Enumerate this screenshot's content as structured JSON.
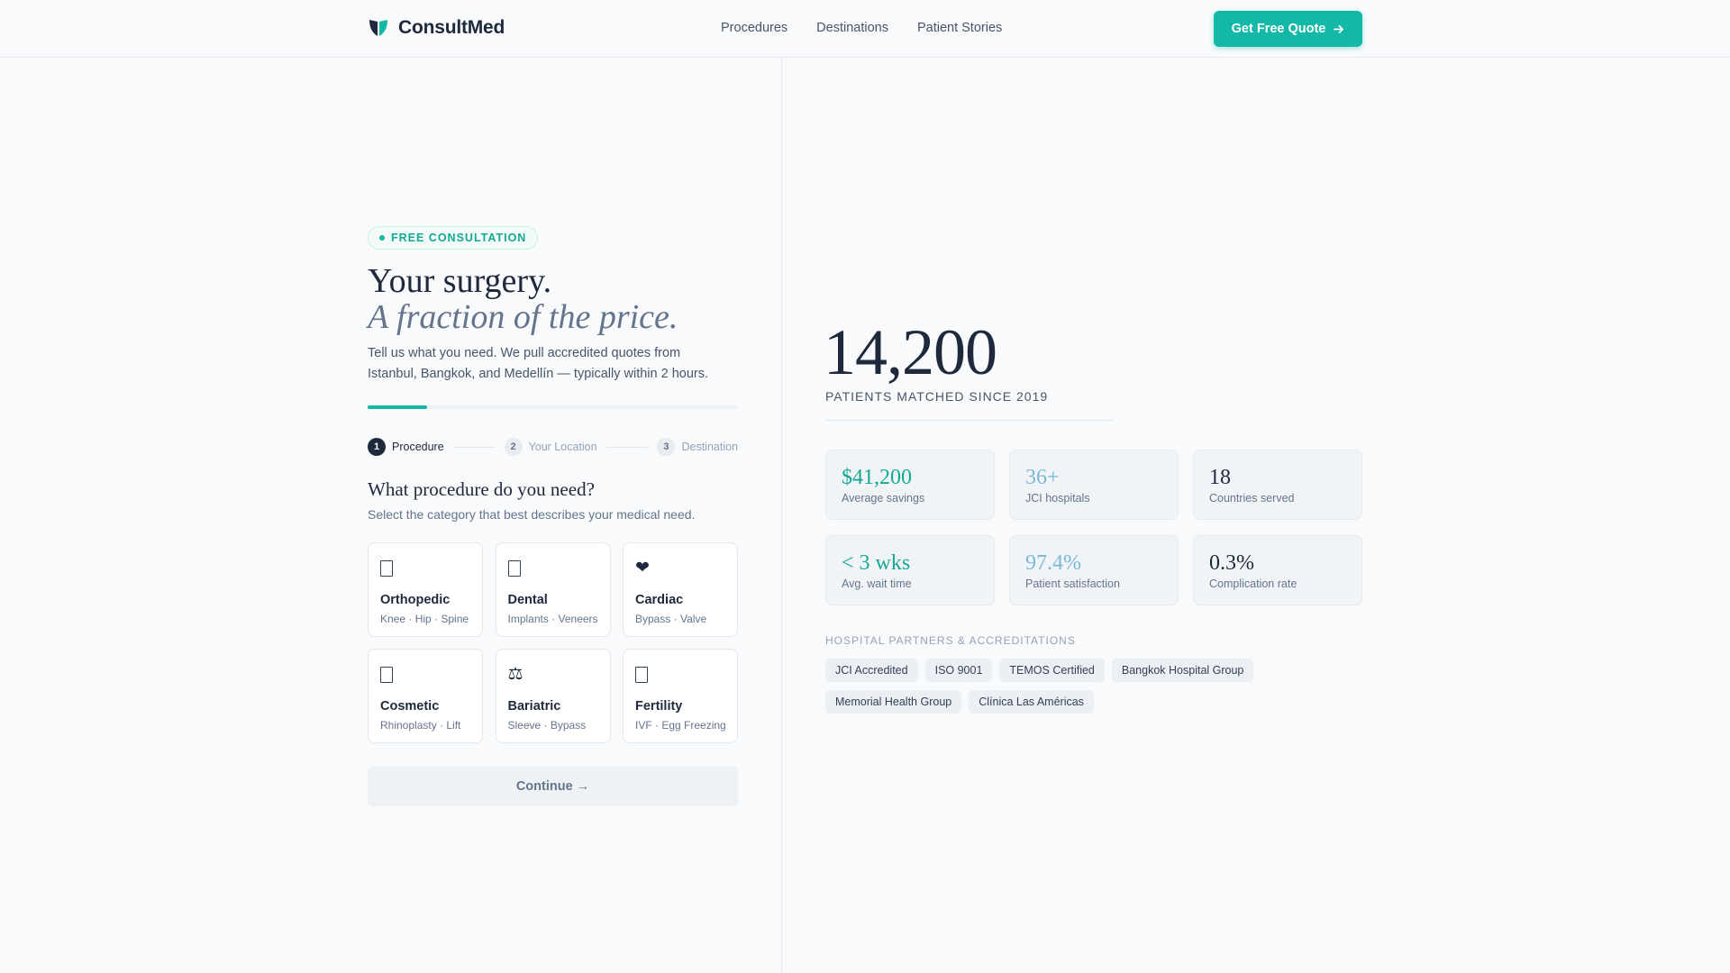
{
  "brand": {
    "name": "ConsultMed",
    "accent": "#14b8a6",
    "dark": "#1e293b"
  },
  "nav": {
    "items": [
      "Procedures",
      "Destinations",
      "Patient Stories"
    ]
  },
  "header": {
    "cta_label": "Get Free Quote"
  },
  "hero": {
    "badge": "FREE CONSULTATION",
    "title_line1": "Your surgery.",
    "title_line2": "A fraction of the price.",
    "lede": "Tell us what you need. We pull accredited quotes from Istanbul, Bangkok, and Medellín — typically within 2 hours.",
    "progress_fraction": 0.16
  },
  "steps": [
    {
      "num": "1",
      "label": "Procedure",
      "active": true
    },
    {
      "num": "2",
      "label": "Your Location",
      "active": false
    },
    {
      "num": "3",
      "label": "Destination",
      "active": false
    }
  ],
  "question": {
    "title": "What procedure do you need?",
    "subtitle": "Select the category that best describes your medical need."
  },
  "procedures": [
    {
      "title": "Orthopedic",
      "sub": "Knee · Hip · Spine",
      "icon": "bone-icon"
    },
    {
      "title": "Dental",
      "sub": "Implants · Veneers",
      "icon": "tooth-icon"
    },
    {
      "title": "Cardiac",
      "sub": "Bypass · Valve",
      "icon": "heart-icon"
    },
    {
      "title": "Cosmetic",
      "sub": "Rhinoplasty · Lift",
      "icon": "sparkle-icon"
    },
    {
      "title": "Bariatric",
      "sub": "Sleeve · Bypass",
      "icon": "scale-icon"
    },
    {
      "title": "Fertility",
      "sub": "IVF · Egg Freezing",
      "icon": "baby-icon"
    }
  ],
  "continue_label": "Continue →",
  "metrics": {
    "big_number": "14,200",
    "big_label": "PATIENTS MATCHED SINCE 2019",
    "stats": [
      {
        "value": "$41,200",
        "label": "Average savings",
        "color": "#14a894"
      },
      {
        "value": "36+",
        "label": "JCI hospitals",
        "color": "#7bb8d6"
      },
      {
        "value": "18",
        "label": "Countries served",
        "color": "#1e293b"
      },
      {
        "value": "< 3 wks",
        "label": "Avg. wait time",
        "color": "#14a894"
      },
      {
        "value": "97.4%",
        "label": "Patient satisfaction",
        "color": "#7bb8d6"
      },
      {
        "value": "0.3%",
        "label": "Complication rate",
        "color": "#1e293b"
      }
    ]
  },
  "partners": {
    "heading": "HOSPITAL PARTNERS & ACCREDITATIONS",
    "items": [
      "JCI Accredited",
      "ISO 9001",
      "TEMOS Certified",
      "Bangkok Hospital Group",
      "Memorial Health Group",
      "Clínica Las Américas"
    ]
  }
}
